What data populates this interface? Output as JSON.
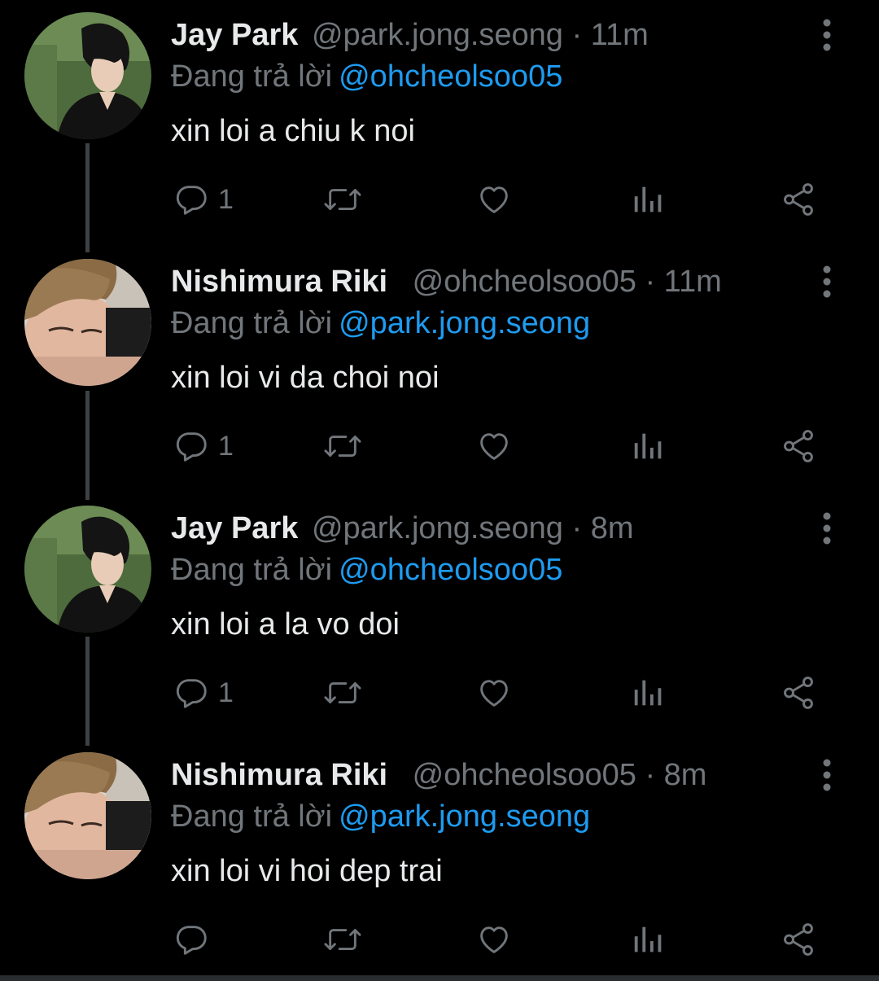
{
  "tweets": [
    {
      "display_name": "Jay Park",
      "handle": "@park.jong.seong",
      "separator": "·",
      "time": "11m",
      "reply_prefix": "Đang trả lời",
      "reply_to": "@ohcheolsoo05",
      "text": "xin loi a chiu k noi",
      "reply_count": "1",
      "avatar": "jay-park-avatar"
    },
    {
      "display_name": "Nishimura Riki",
      "handle": "@ohcheolsoo05",
      "separator": "·",
      "time": "11m",
      "reply_prefix": "Đang trả lời",
      "reply_to": "@park.jong.seong",
      "text": "xin loi vi da choi noi",
      "reply_count": "1",
      "avatar": "nishimura-riki-avatar"
    },
    {
      "display_name": "Jay Park",
      "handle": "@park.jong.seong",
      "separator": "·",
      "time": "8m",
      "reply_prefix": "Đang trả lời",
      "reply_to": "@ohcheolsoo05",
      "text": "xin loi a la vo doi",
      "reply_count": "1",
      "avatar": "jay-park-avatar"
    },
    {
      "display_name": "Nishimura Riki",
      "handle": "@ohcheolsoo05",
      "separator": "·",
      "time": "8m",
      "reply_prefix": "Đang trả lời",
      "reply_to": "@park.jong.seong",
      "text": "xin loi vi hoi dep trai",
      "reply_count": "",
      "avatar": "nishimura-riki-avatar"
    }
  ],
  "colors": {
    "background": "#000000",
    "text": "#e7e9ea",
    "muted": "#71767b",
    "link": "#1d9bf0",
    "thread_line": "#3e4144"
  },
  "icons": [
    "reply-icon",
    "retweet-icon",
    "like-icon",
    "views-icon",
    "share-icon",
    "more-icon"
  ]
}
